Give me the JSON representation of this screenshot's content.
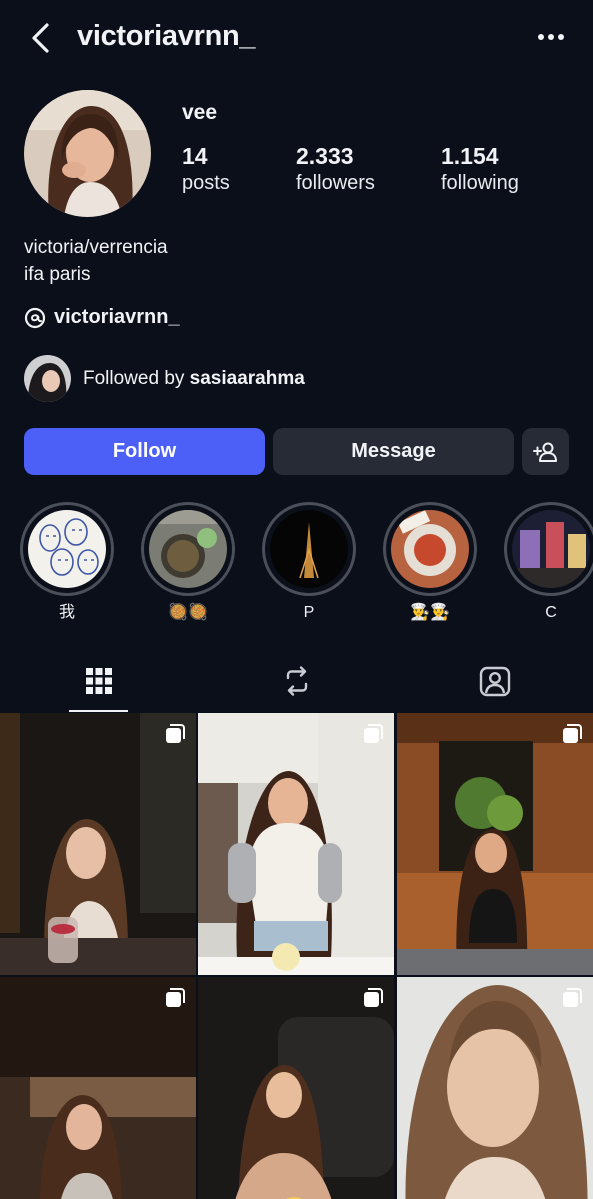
{
  "header": {
    "username": "victoriavrnn_",
    "back_icon": "chevron-left-icon",
    "more_icon": "more-horizontal-icon"
  },
  "profile": {
    "display_name": "vee",
    "stats": [
      {
        "value": "14",
        "label": "posts"
      },
      {
        "value": "2.333",
        "label": "followers"
      },
      {
        "value": "1.154",
        "label": "following"
      }
    ],
    "bio": [
      "victoria/verrencia",
      "ifa paris"
    ],
    "threads_handle": "victoriavrnn_",
    "followed_by_prefix": "Followed by",
    "followed_by_user": "sasiaarahma"
  },
  "actions": {
    "follow_label": "Follow",
    "message_label": "Message",
    "add_person_icon": "add-person-icon"
  },
  "highlights": [
    {
      "caption": "我"
    },
    {
      "caption": "🥘🥘"
    },
    {
      "caption": "P"
    },
    {
      "caption": "👨‍🍳👨‍🍳"
    },
    {
      "caption": "C"
    }
  ],
  "tabs": [
    {
      "icon": "grid-icon",
      "active": true
    },
    {
      "icon": "reels-repost-icon",
      "active": false
    },
    {
      "icon": "tagged-person-icon",
      "active": false
    }
  ],
  "colors": {
    "background": "#0b0f1a",
    "follow_button": "#4c5ff7",
    "secondary_button": "#262b36",
    "text": "#f1f3f6"
  }
}
